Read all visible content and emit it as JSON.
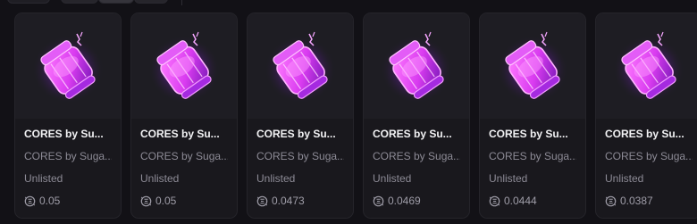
{
  "colors": {
    "background": "#121116",
    "card": "#19181d",
    "thumb": "#1e1d23",
    "accent_pink": "#e040ff",
    "text_primary": "#f2f2f4",
    "text_muted": "#8d8b96"
  },
  "cards": [
    {
      "title": "CORES by Su...",
      "collection": "CORES by Suga...",
      "status": "Unlisted",
      "price": "0.05",
      "icon": "ore-chunk-icon"
    },
    {
      "title": "CORES by Su...",
      "collection": "CORES by Suga...",
      "status": "Unlisted",
      "price": "0.05",
      "icon": "ore-chunk-icon"
    },
    {
      "title": "CORES by Su...",
      "collection": "CORES by Suga...",
      "status": "Unlisted",
      "price": "0.0473",
      "icon": "ore-chunk-icon"
    },
    {
      "title": "CORES by Su...",
      "collection": "CORES by Suga...",
      "status": "Unlisted",
      "price": "0.0469",
      "icon": "ore-chunk-icon"
    },
    {
      "title": "CORES by Su...",
      "collection": "CORES by Suga...",
      "status": "Unlisted",
      "price": "0.0444",
      "icon": "ore-chunk-icon"
    },
    {
      "title": "CORES by Su...",
      "collection": "CORES by Suga...",
      "status": "Unlisted",
      "price": "0.0387",
      "icon": "ore-chunk-icon"
    }
  ]
}
